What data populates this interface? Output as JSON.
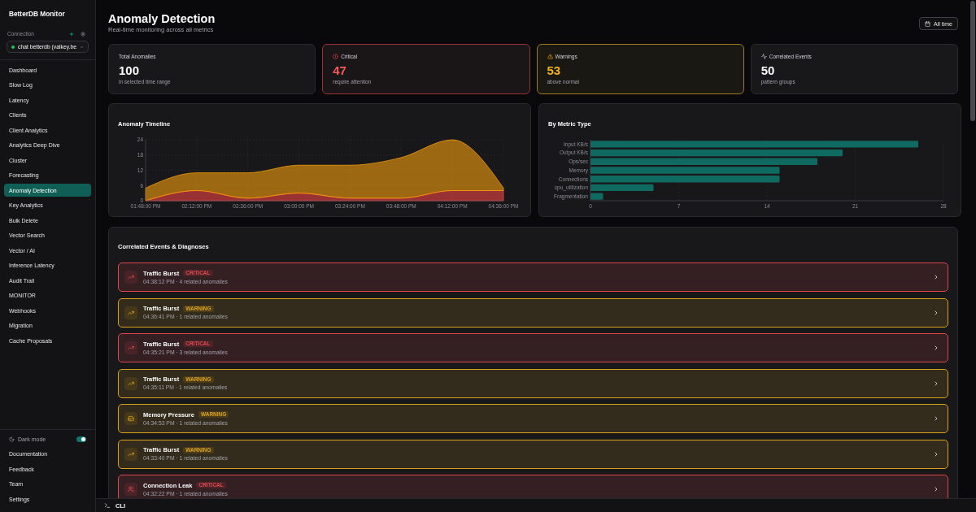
{
  "sidebar": {
    "brand": "BetterDB Monitor",
    "connection": {
      "label": "Connection",
      "value": "chat betterdb (valkey.be",
      "connected": true
    },
    "items": [
      {
        "label": "Dashboard",
        "selected": false
      },
      {
        "label": "Slow Log",
        "selected": false
      },
      {
        "label": "Latency",
        "selected": false
      },
      {
        "label": "Clients",
        "selected": false
      },
      {
        "label": "Client Analytics",
        "selected": false
      },
      {
        "label": "Analytics Deep Dive",
        "selected": false
      },
      {
        "label": "Cluster",
        "selected": false
      },
      {
        "label": "Forecasting",
        "selected": false
      },
      {
        "label": "Anomaly Detection",
        "selected": true
      },
      {
        "label": "Key Analytics",
        "selected": false
      },
      {
        "label": "Bulk Delete",
        "selected": false
      },
      {
        "label": "Vector Search",
        "selected": false
      },
      {
        "label": "Vector / AI",
        "selected": false
      },
      {
        "label": "Inference Latency",
        "selected": false
      },
      {
        "label": "Audit Trail",
        "selected": false
      },
      {
        "label": "MONITOR",
        "selected": false
      },
      {
        "label": "Webhooks",
        "selected": false
      },
      {
        "label": "Migration",
        "selected": false
      },
      {
        "label": "Cache Proposals",
        "selected": false
      }
    ],
    "dark_mode": {
      "label": "Dark mode",
      "on": true
    },
    "footer_links": [
      "Documentation",
      "Feedback",
      "Team",
      "Settings"
    ]
  },
  "header": {
    "title": "Anomaly Detection",
    "subtitle": "Real-time monitoring across all metrics",
    "range_button": "All time"
  },
  "stats": [
    {
      "kind": "total",
      "label": "Total Anomalies",
      "value": "100",
      "caption": "in selected time range"
    },
    {
      "kind": "critical",
      "label": "Critical",
      "value": "47",
      "caption": "require attention"
    },
    {
      "kind": "warning",
      "label": "Warnings",
      "value": "53",
      "caption": "above normal"
    },
    {
      "kind": "correlated",
      "label": "Correlated Events",
      "value": "50",
      "caption": "pattern groups"
    }
  ],
  "timeline": {
    "chart_data": {
      "type": "area",
      "title": "Anomaly Timeline",
      "categories": [
        "01:48:00 PM",
        "02:12:00 PM",
        "02:36:00 PM",
        "03:00:00 PM",
        "03:24:00 PM",
        "03:48:00 PM",
        "04:12:00 PM",
        "04:36:00 PM"
      ],
      "series": [
        {
          "color": "#ef4444",
          "values": [
            0,
            4,
            1,
            3,
            1,
            1,
            4,
            4
          ]
        },
        {
          "color": "#f59e0b",
          "values": [
            5,
            7,
            10,
            11,
            13,
            16,
            20,
            1
          ]
        }
      ],
      "stacked": true,
      "grid": true,
      "ylim": [
        0,
        24
      ],
      "yticks": [
        0,
        6,
        12,
        18,
        24
      ]
    }
  },
  "metric_types": {
    "chart_data": {
      "type": "bar",
      "title": "By Metric Type",
      "orientation": "horizontal",
      "categories": [
        "Input KB/s",
        "Output KB/s",
        "Ops/sec",
        "Memory",
        "Connections",
        "cpu_utilization",
        "Fragmentation"
      ],
      "series": [
        {
          "color": "#0f6b61",
          "values": [
            26,
            20,
            18,
            15,
            15,
            5,
            1
          ]
        }
      ],
      "grid": true,
      "xlim": [
        0,
        28
      ],
      "xticks": [
        0,
        7,
        14,
        21,
        28
      ]
    }
  },
  "events": {
    "title": "Correlated Events & Diagnoses",
    "items": [
      {
        "kind": "traffic",
        "title": "Traffic Burst",
        "color": "#e0474d",
        "badge": "CRITICAL",
        "meta": "04:38:12 PM · 4 related anomalies"
      },
      {
        "kind": "traffic",
        "title": "Traffic Burst",
        "color": "#d9a21b",
        "badge": "WARNING",
        "meta": "04:36:41 PM · 1 related anomalies"
      },
      {
        "kind": "traffic",
        "title": "Traffic Burst",
        "color": "#e0474d",
        "badge": "CRITICAL",
        "meta": "04:35:21 PM · 3 related anomalies"
      },
      {
        "kind": "traffic",
        "title": "Traffic Burst",
        "color": "#d9a21b",
        "badge": "WARNING",
        "meta": "04:35:11 PM · 1 related anomalies"
      },
      {
        "kind": "memory",
        "title": "Memory Pressure",
        "color": "#d9a21b",
        "badge": "WARNING",
        "meta": "04:34:53 PM · 1 related anomalies"
      },
      {
        "kind": "traffic",
        "title": "Traffic Burst",
        "color": "#d9a21b",
        "badge": "WARNING",
        "meta": "04:33:40 PM · 1 related anomalies"
      },
      {
        "kind": "connection",
        "title": "Connection Leak",
        "color": "#e0474d",
        "badge": "CRITICAL",
        "meta": "04:32:22 PM · 1 related anomalies"
      }
    ]
  },
  "cli": {
    "label": "CLI"
  }
}
